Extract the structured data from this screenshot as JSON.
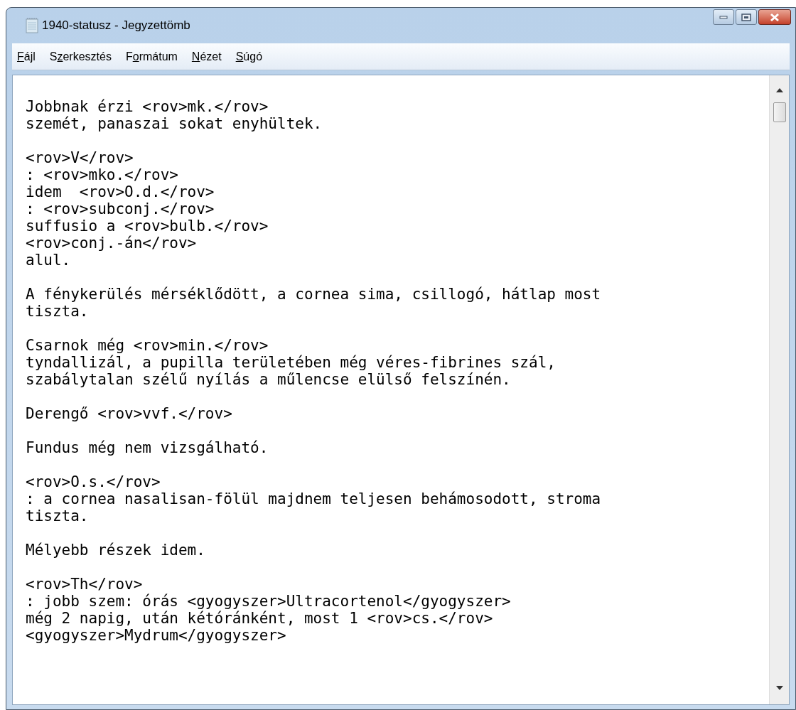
{
  "window": {
    "title": "1940-statusz - Jegyzettömb"
  },
  "menu": [
    {
      "access_key": "F",
      "after": "ájl"
    },
    {
      "before": "S",
      "access_key": "z",
      "after": "erkesztés"
    },
    {
      "before": "F",
      "access_key": "o",
      "after": "rmátum"
    },
    {
      "access_key": "N",
      "after": "ézet"
    },
    {
      "access_key": "S",
      "after": "úgó"
    }
  ],
  "document": {
    "paragraphs": [
      [
        "Jobbnak érzi <rov>mk.</rov>",
        "szemét, panaszai sokat enyhültek."
      ],
      [
        "<rov>V</rov>",
        ": <rov>mko.</rov>",
        "idem  <rov>O.d.</rov>",
        ": <rov>subconj.</rov>",
        "suffusio a <rov>bulb.</rov>",
        "<rov>conj.-án</rov>",
        "alul."
      ],
      [
        "A fénykerülés mérséklődött, a cornea sima, csillogó, hátlap most",
        "tiszta."
      ],
      [
        "Csarnok még <rov>min.</rov>",
        "tyndallizál, a pupilla területében még véres-fibrines szál,",
        "szabálytalan szélű nyílás a műlencse elülső felszínén."
      ],
      [
        "Derengő <rov>vvf.</rov>"
      ],
      [
        "Fundus még nem vizsgálható."
      ],
      [
        "<rov>O.s.</rov>",
        ": a cornea nasalisan-fölül majdnem teljesen behámosodott, stroma",
        "tiszta."
      ],
      [
        "Mélyebb részek idem."
      ],
      [
        "<rov>Th</rov>",
        ": jobb szem: órás <gyogyszer>Ultracortenol</gyogyszer>",
        "még 2 napig, után kétóránként, most 1 <rov>cs.</rov>",
        "<gyogyszer>Mydrum</gyogyszer>"
      ]
    ]
  }
}
